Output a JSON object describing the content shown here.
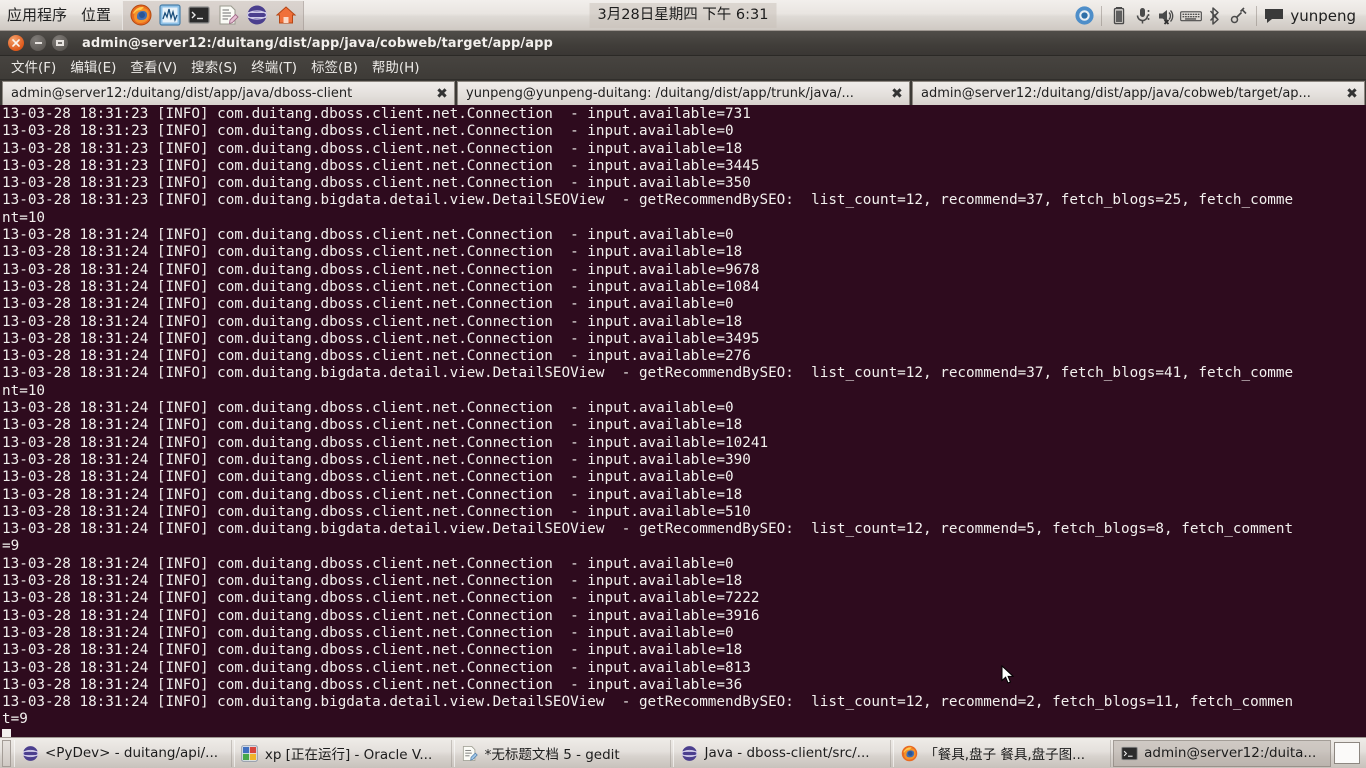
{
  "top_panel": {
    "menus": [
      "应用程序",
      "位置"
    ],
    "launchers": [
      {
        "name": "firefox-icon",
        "title": "Firefox"
      },
      {
        "name": "system-monitor-icon",
        "title": "System Monitor"
      },
      {
        "name": "terminal-icon",
        "title": "Terminal"
      },
      {
        "name": "gedit-icon",
        "title": "gedit"
      },
      {
        "name": "eclipse-icon",
        "title": "Eclipse"
      },
      {
        "name": "home-folder-icon",
        "title": "Home"
      }
    ],
    "clock": "3月28日星期四 下午 6:31",
    "tray": [
      {
        "name": "chrome-icon"
      },
      {
        "name": "battery-icon"
      },
      {
        "name": "microphone-icon"
      },
      {
        "name": "volume-muted-icon"
      },
      {
        "name": "keyboard-icon"
      },
      {
        "name": "bluetooth-icon"
      },
      {
        "name": "network-disconnected-icon"
      },
      {
        "name": "chat-icon"
      }
    ],
    "user": "yunpeng"
  },
  "window": {
    "title": "admin@server12:/duitang/dist/app/java/cobweb/target/app/app",
    "buttons": {
      "close": "close-button",
      "minimize": "minimize-button",
      "maximize": "maximize-button"
    },
    "menubar": [
      "文件(F)",
      "编辑(E)",
      "查看(V)",
      "搜索(S)",
      "终端(T)",
      "标签(B)",
      "帮助(H)"
    ],
    "tabs": [
      {
        "label": "admin@server12:/duitang/dist/app/java/dboss-client",
        "close": "✖",
        "active": false
      },
      {
        "label": "yunpeng@yunpeng-duitang: /duitang/dist/app/trunk/java/...",
        "close": "✖",
        "active": false
      },
      {
        "label": "admin@server12:/duitang/dist/app/java/cobweb/target/ap...",
        "close": "✖",
        "active": true
      }
    ]
  },
  "terminal": {
    "colors": {
      "background": "#2e0b1e",
      "foreground": "#f2f0ee"
    },
    "lines": [
      "13-03-28 18:31:23 [INFO] com.duitang.dboss.client.net.Connection  - input.available=731",
      "13-03-28 18:31:23 [INFO] com.duitang.dboss.client.net.Connection  - input.available=0",
      "13-03-28 18:31:23 [INFO] com.duitang.dboss.client.net.Connection  - input.available=18",
      "13-03-28 18:31:23 [INFO] com.duitang.dboss.client.net.Connection  - input.available=3445",
      "13-03-28 18:31:23 [INFO] com.duitang.dboss.client.net.Connection  - input.available=350",
      "13-03-28 18:31:23 [INFO] com.duitang.bigdata.detail.view.DetailSEOView  - getRecommendBySEO:  list_count=12, recommend=37, fetch_blogs=25, fetch_comme",
      "nt=10",
      "13-03-28 18:31:24 [INFO] com.duitang.dboss.client.net.Connection  - input.available=0",
      "13-03-28 18:31:24 [INFO] com.duitang.dboss.client.net.Connection  - input.available=18",
      "13-03-28 18:31:24 [INFO] com.duitang.dboss.client.net.Connection  - input.available=9678",
      "13-03-28 18:31:24 [INFO] com.duitang.dboss.client.net.Connection  - input.available=1084",
      "13-03-28 18:31:24 [INFO] com.duitang.dboss.client.net.Connection  - input.available=0",
      "13-03-28 18:31:24 [INFO] com.duitang.dboss.client.net.Connection  - input.available=18",
      "13-03-28 18:31:24 [INFO] com.duitang.dboss.client.net.Connection  - input.available=3495",
      "13-03-28 18:31:24 [INFO] com.duitang.dboss.client.net.Connection  - input.available=276",
      "13-03-28 18:31:24 [INFO] com.duitang.bigdata.detail.view.DetailSEOView  - getRecommendBySEO:  list_count=12, recommend=37, fetch_blogs=41, fetch_comme",
      "nt=10",
      "13-03-28 18:31:24 [INFO] com.duitang.dboss.client.net.Connection  - input.available=0",
      "13-03-28 18:31:24 [INFO] com.duitang.dboss.client.net.Connection  - input.available=18",
      "13-03-28 18:31:24 [INFO] com.duitang.dboss.client.net.Connection  - input.available=10241",
      "13-03-28 18:31:24 [INFO] com.duitang.dboss.client.net.Connection  - input.available=390",
      "13-03-28 18:31:24 [INFO] com.duitang.dboss.client.net.Connection  - input.available=0",
      "13-03-28 18:31:24 [INFO] com.duitang.dboss.client.net.Connection  - input.available=18",
      "13-03-28 18:31:24 [INFO] com.duitang.dboss.client.net.Connection  - input.available=510",
      "13-03-28 18:31:24 [INFO] com.duitang.bigdata.detail.view.DetailSEOView  - getRecommendBySEO:  list_count=12, recommend=5, fetch_blogs=8, fetch_comment",
      "=9",
      "13-03-28 18:31:24 [INFO] com.duitang.dboss.client.net.Connection  - input.available=0",
      "13-03-28 18:31:24 [INFO] com.duitang.dboss.client.net.Connection  - input.available=18",
      "13-03-28 18:31:24 [INFO] com.duitang.dboss.client.net.Connection  - input.available=7222",
      "13-03-28 18:31:24 [INFO] com.duitang.dboss.client.net.Connection  - input.available=3916",
      "13-03-28 18:31:24 [INFO] com.duitang.dboss.client.net.Connection  - input.available=0",
      "13-03-28 18:31:24 [INFO] com.duitang.dboss.client.net.Connection  - input.available=18",
      "13-03-28 18:31:24 [INFO] com.duitang.dboss.client.net.Connection  - input.available=813",
      "13-03-28 18:31:24 [INFO] com.duitang.dboss.client.net.Connection  - input.available=36",
      "13-03-28 18:31:24 [INFO] com.duitang.bigdata.detail.view.DetailSEOView  - getRecommendBySEO:  list_count=12, recommend=2, fetch_blogs=11, fetch_commen",
      "t=9"
    ]
  },
  "taskbar": {
    "tasks": [
      {
        "label": "<PyDev> - duitang/api/...",
        "icon": "eclipse-icon",
        "active": false
      },
      {
        "label": "xp [正在运行] - Oracle V...",
        "icon": "virtualbox-icon",
        "active": false
      },
      {
        "label": "*无标题文档 5 - gedit",
        "icon": "gedit-icon",
        "active": false
      },
      {
        "label": "Java - dboss-client/src/...",
        "icon": "eclipse-icon",
        "active": false
      },
      {
        "label": "「餐具,盘子 餐具,盘子图...",
        "icon": "firefox-icon",
        "active": false
      },
      {
        "label": "admin@server12:/duita...",
        "icon": "terminal-icon",
        "active": true
      }
    ]
  }
}
